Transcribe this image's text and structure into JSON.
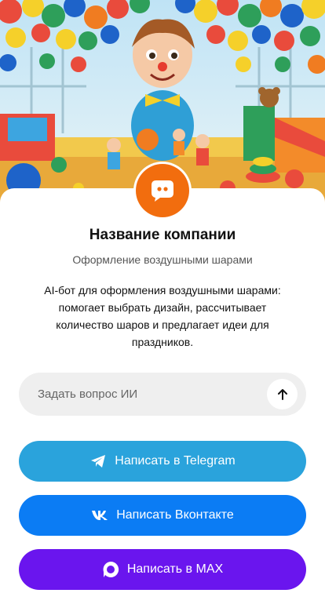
{
  "company": {
    "name": "Название компании",
    "tagline": "Оформление воздушными шарами",
    "description": "AI-бот для оформления воздушными шарами: помогает выбрать дизайн, рассчитывает количество шаров и предлагает идеи для праздников."
  },
  "hero": {
    "icon": "balloon-party-illustration"
  },
  "logo": {
    "icon": "chat-bubble-icon",
    "color": "#f26d0e"
  },
  "ask": {
    "placeholder": "Задать вопрос ИИ",
    "send_icon": "arrow-up-icon"
  },
  "buttons": {
    "telegram": {
      "label": "Написать в Telegram",
      "icon": "telegram-icon",
      "color": "#2aa3dc"
    },
    "vk": {
      "label": "Написать Вконтакте",
      "icon": "vk-icon",
      "color": "#0b7cf4"
    },
    "max": {
      "label": "Написать в MAX",
      "icon": "max-icon",
      "color": "#6a15ee"
    }
  }
}
